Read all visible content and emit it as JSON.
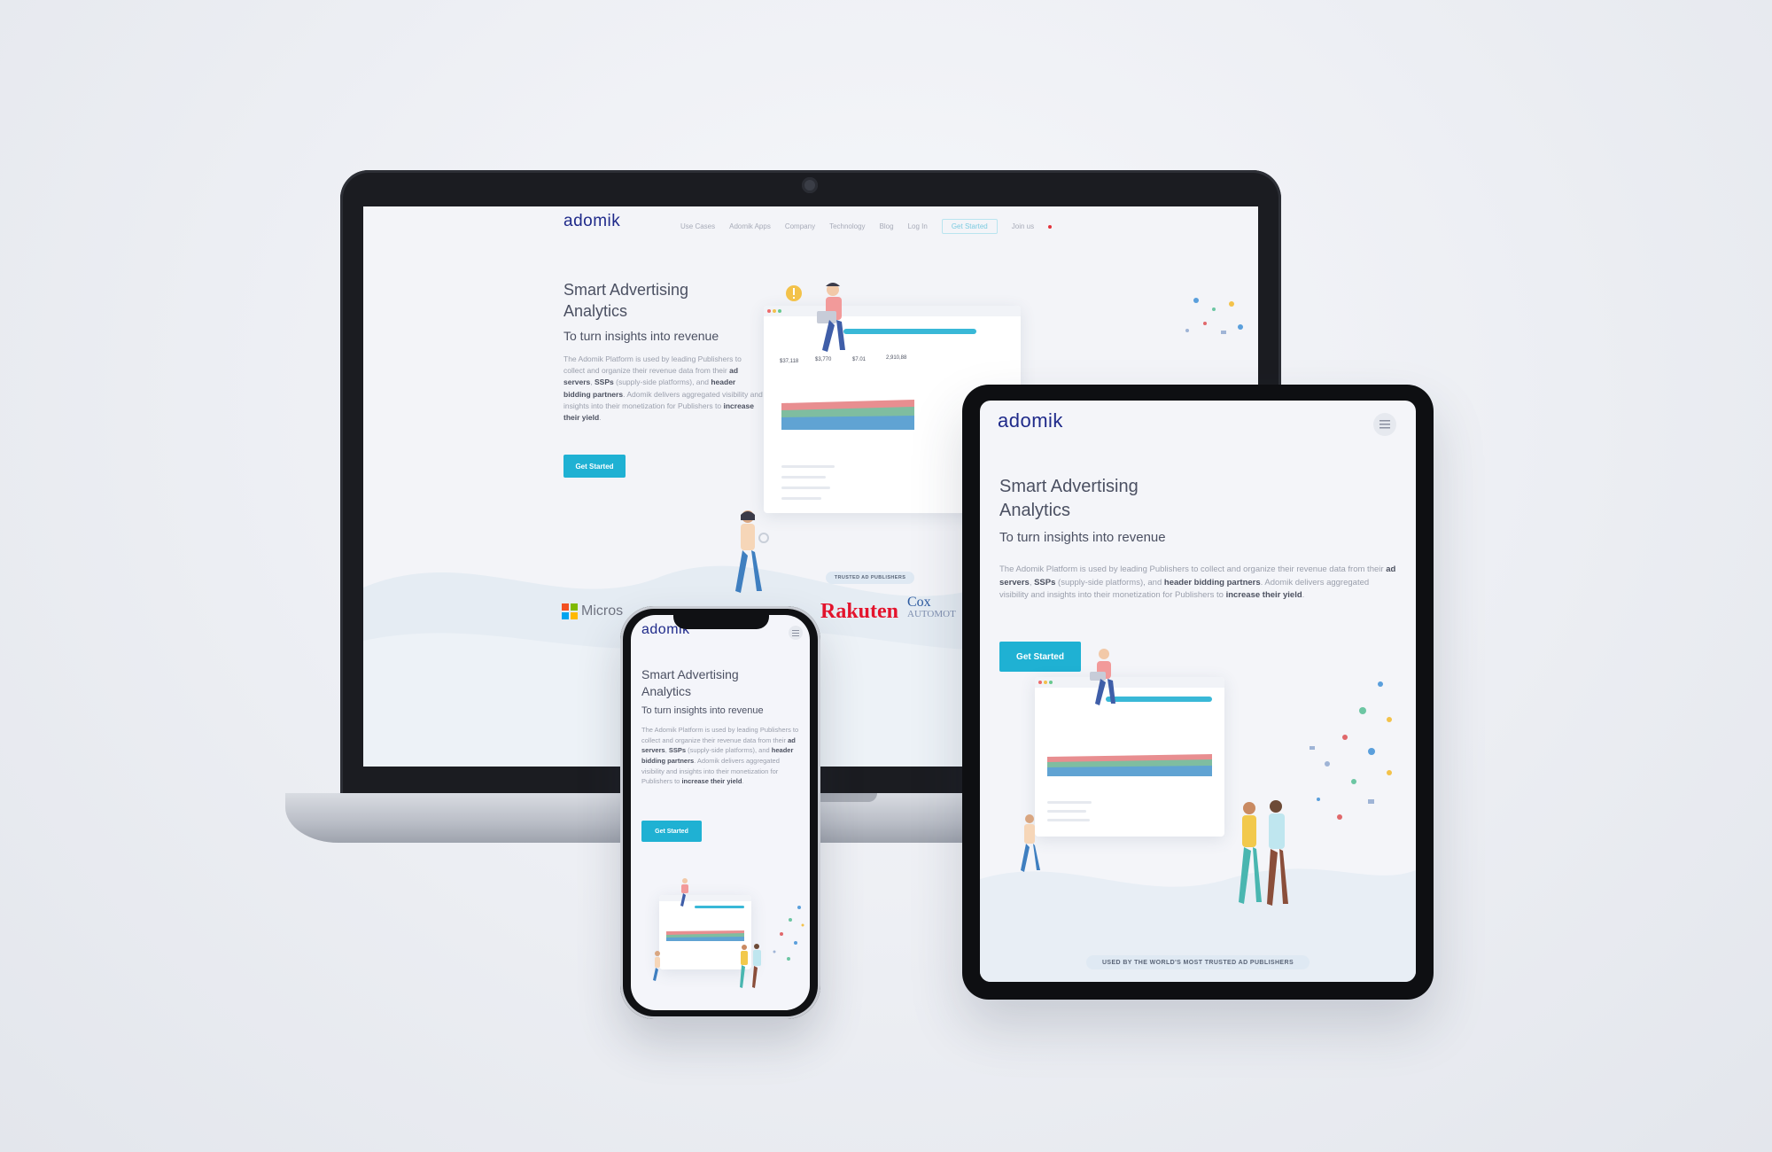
{
  "site": {
    "logo_text": "adomik",
    "nav": {
      "items": [
        "Use Cases",
        "Adomik Apps",
        "Company",
        "Technology",
        "Blog",
        "Log In"
      ],
      "cta": "Get Started",
      "lang": "Join us"
    },
    "hero": {
      "title_line1": "Smart Advertising",
      "title_line2": "Analytics",
      "subtitle": "To turn insights into revenue",
      "body": {
        "p1": "The Adomik Platform is used by leading Publishers to collect and organize their revenue data from their ",
        "b1": "ad servers",
        "p2": ", ",
        "b2": "SSPs",
        "p3": " (supply-side platforms), and ",
        "b3": "header bidding partners",
        "p4": ". Adomik delivers aggregated visibility and insights into their monetization for Publishers to ",
        "b4": "increase their yield",
        "p5": "."
      },
      "cta_label": "Get Started"
    },
    "trusted_banner": "USED BY THE WORLD'S MOST TRUSTED AD PUBLISHERS",
    "trusted_banner_short": "TRUSTED AD PUBLISHERS",
    "brands": {
      "microsoft": "Micros",
      "rakuten": "Rakuten",
      "cox_line1": "Cox",
      "cox_line2": "AUTOMOT"
    },
    "dashboard_kpis": [
      "$37,118",
      "$3,770",
      "$7.01",
      "2,910,88"
    ]
  },
  "colors": {
    "brand_blue": "#1f2a8a",
    "cta_cyan": "#1fb1d3",
    "chart_red": "#e0686b",
    "chart_green": "#6cc6a3",
    "chart_blue": "#5a9fdc"
  },
  "icons": {
    "menu": "hamburger-icon",
    "alert": "exclamation-icon"
  }
}
